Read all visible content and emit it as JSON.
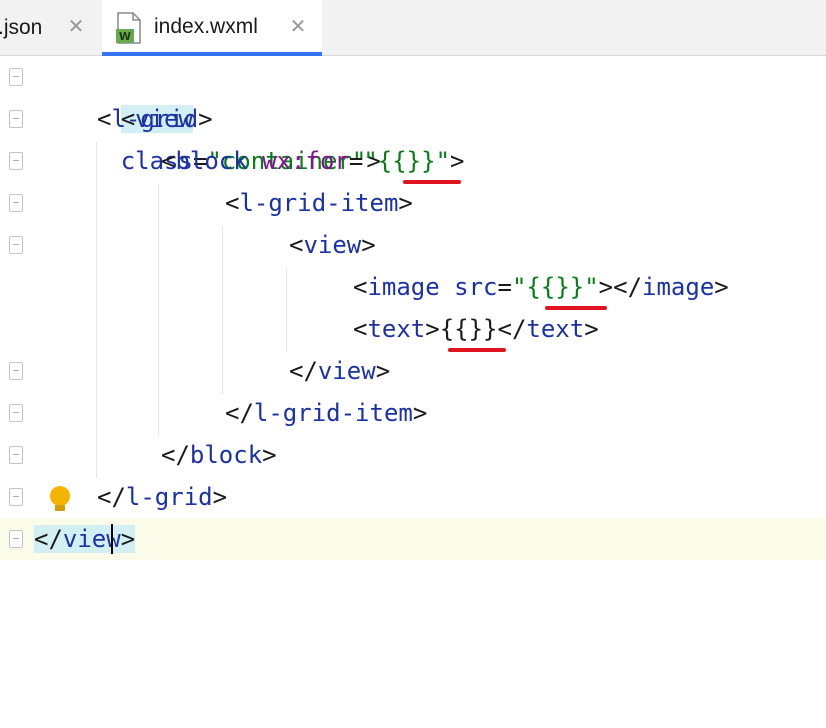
{
  "tabs": [
    {
      "label": ".json",
      "active": false,
      "close": "✕"
    },
    {
      "label": "index.wxml",
      "active": true,
      "close": "✕",
      "icon_letter": "W"
    }
  ],
  "colors": {
    "tag": "#1a32a6",
    "attribute_wx": "#871094",
    "string": "#067d17",
    "tag_match_highlight": "#d2f0f4",
    "error_underline": "#e0141e",
    "active_tab_underline": "#3574f0",
    "intention_bulb": "#f4b400"
  },
  "code": {
    "l1": {
      "open": "<",
      "tag": "view",
      "attr": "class",
      "eq": "=",
      "val": "\"container\"",
      "close": ">"
    },
    "l2": {
      "open": "<",
      "tag": "l-grid",
      "close": ">"
    },
    "l3": {
      "open": "<",
      "tag": "block",
      "attr": "wx:for",
      "eq": "=",
      "q1": "\"",
      "val": "{{}}",
      "q2": "\"",
      "close": ">"
    },
    "l4": {
      "open": "<",
      "tag": "l-grid-item",
      "close": ">"
    },
    "l5": {
      "open": "<",
      "tag": "view",
      "close": ">"
    },
    "l6": {
      "open": "<",
      "tag": "image",
      "attr": "src",
      "eq": "=",
      "q1": "\"",
      "val": "{{}}",
      "q2": "\"",
      "close": ">",
      "end_open": "</",
      "end_tag": "image",
      "end_close": ">"
    },
    "l7": {
      "open": "<",
      "tag": "text",
      "close": ">",
      "val": "{{}}",
      "end_open": "</",
      "end_tag": "text",
      "end_close": ">"
    },
    "l8": {
      "open": "</",
      "tag": "view",
      "close": ">"
    },
    "l9": {
      "open": "</",
      "tag": "l-grid-item",
      "close": ">"
    },
    "l10": {
      "open": "</",
      "tag": "block",
      "close": ">"
    },
    "l11": {
      "open": "</",
      "tag": "l-grid",
      "close": ">"
    },
    "l12": {
      "open": "</",
      "tag_a": "vie",
      "tag_b": "w",
      "close": ">"
    }
  },
  "icons": {
    "intention": "lightbulb-icon",
    "file": "wxml-file-icon",
    "fold": "fold-marker-icon"
  }
}
